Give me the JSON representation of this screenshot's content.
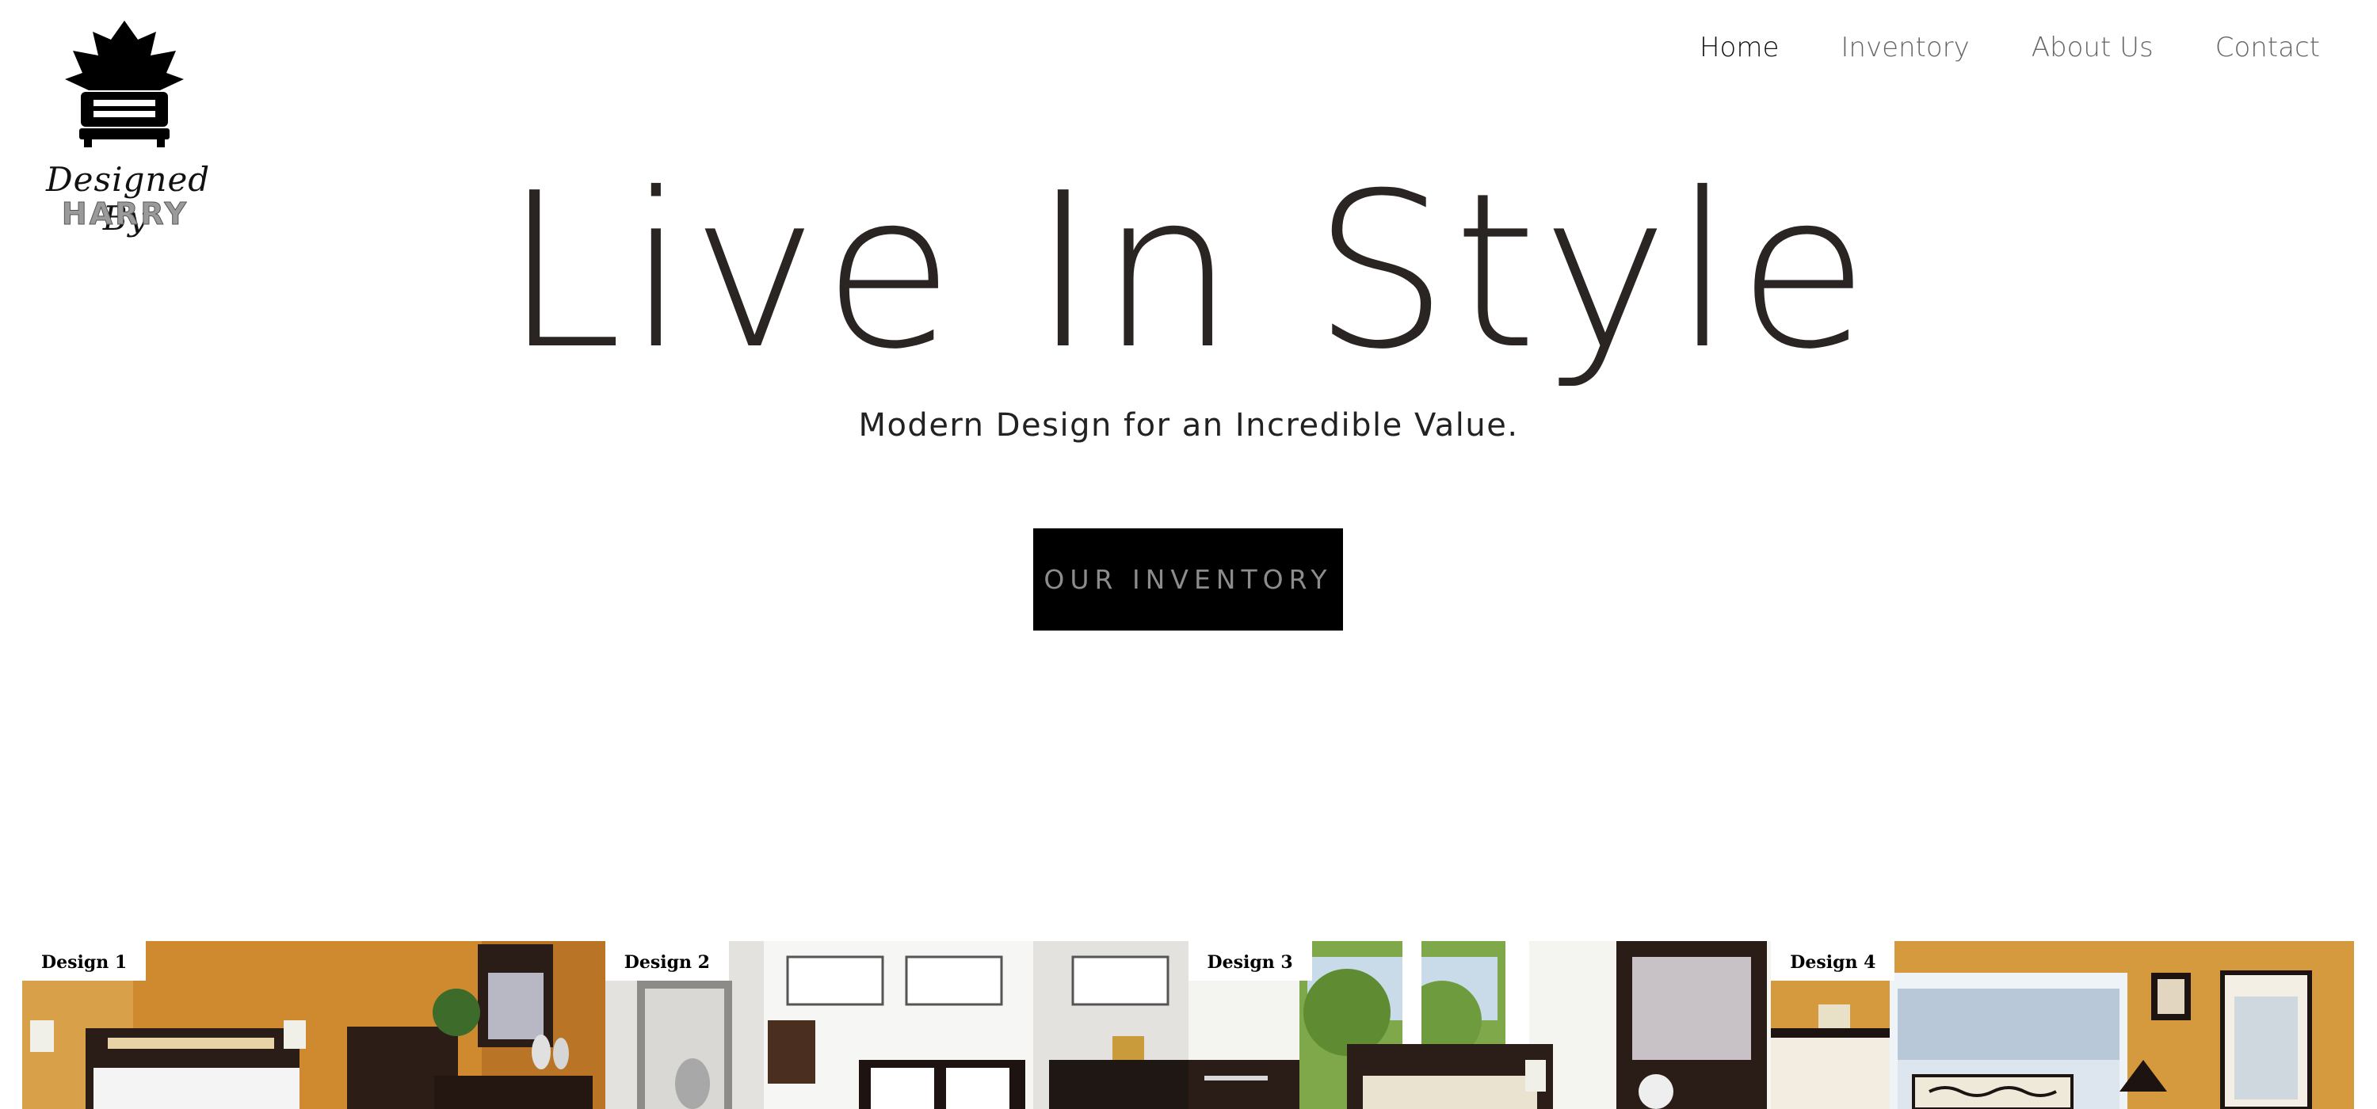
{
  "brand": {
    "script": "Designed By",
    "name": "HARRY"
  },
  "nav": {
    "items": [
      {
        "label": "Home",
        "active": true
      },
      {
        "label": "Inventory",
        "active": false
      },
      {
        "label": "About Us",
        "active": false
      },
      {
        "label": "Contact",
        "active": false
      }
    ]
  },
  "hero": {
    "title": "Live In Style",
    "subtitle": "Modern Design for an Incredible Value.",
    "cta_label": "OUR INVENTORY"
  },
  "designs": [
    {
      "label": "Design 1",
      "wall_color": "#d08a2e"
    },
    {
      "label": "Design 2",
      "wall_color": "#e6e4e1"
    },
    {
      "label": "Design 3",
      "wall_color": "#f2f2ef"
    },
    {
      "label": "Design 4",
      "wall_color": "#d89a3c"
    }
  ],
  "colors": {
    "text_dark": "#2a2522",
    "nav_inactive": "#666666",
    "cta_background": "#000000",
    "cta_text": "#8c8c8c"
  }
}
